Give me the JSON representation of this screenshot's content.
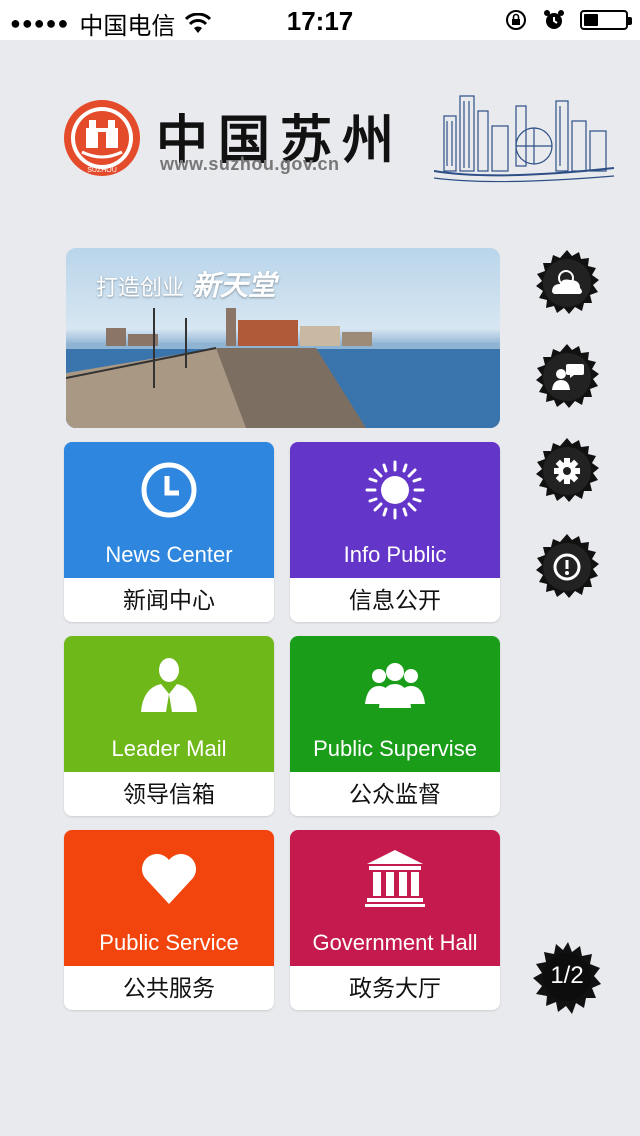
{
  "status_bar": {
    "signal_dots": "●●●●●",
    "carrier": "中国电信",
    "time": "17:17",
    "battery_level": 0.35
  },
  "header": {
    "title": "中国苏州",
    "url": "www.suzhou.gov.cn",
    "seal_text": "SUZHOU"
  },
  "banner": {
    "text": "打造创业",
    "emphasis": "新天堂"
  },
  "tiles": [
    {
      "en": "News Center",
      "zh": "新闻中心",
      "color": "#2e86de",
      "icon": "clock-icon"
    },
    {
      "en": "Info Public",
      "zh": "信息公开",
      "color": "#6435c9",
      "icon": "sun-icon"
    },
    {
      "en": "Leader Mail",
      "zh": "领导信箱",
      "color": "#6fb81a",
      "icon": "leader-icon"
    },
    {
      "en": "Public Supervise",
      "zh": "公众监督",
      "color": "#1a9e1a",
      "icon": "group-icon"
    },
    {
      "en": "Public Service",
      "zh": "公共服务",
      "color": "#f2450d",
      "icon": "heart-icon"
    },
    {
      "en": "Government Hall",
      "zh": "政务大厅",
      "color": "#c41a4e",
      "icon": "building-icon"
    }
  ],
  "side_buttons": [
    "weather-icon",
    "feedback-icon",
    "gear-icon",
    "info-icon"
  ],
  "pager": {
    "text": "1/2"
  }
}
